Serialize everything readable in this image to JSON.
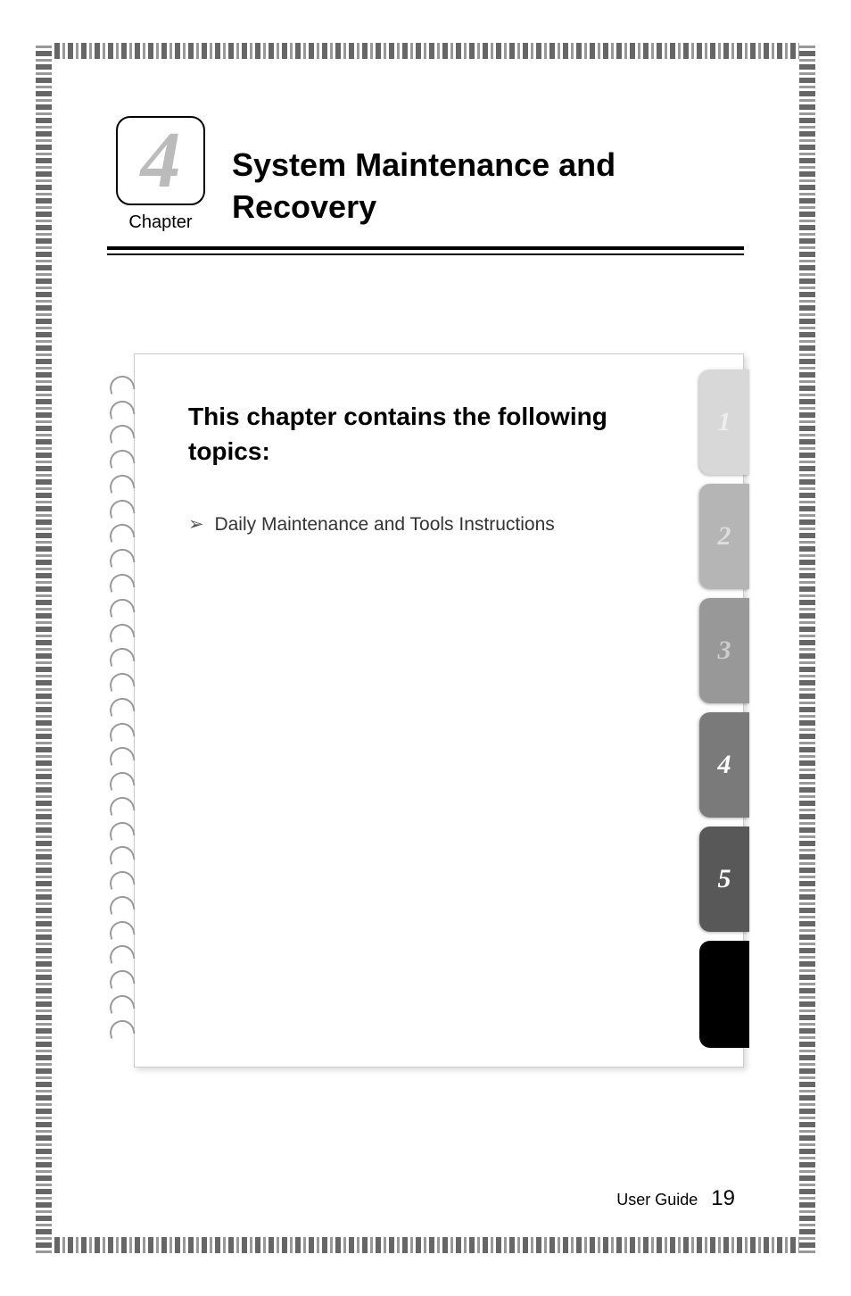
{
  "chapter": {
    "number": "4",
    "label": "Chapter",
    "title": "System Maintenance and Recovery"
  },
  "topics": {
    "heading": "This chapter contains the following topics:",
    "items": [
      "Daily Maintenance and Tools Instructions"
    ]
  },
  "tabs": [
    "1",
    "2",
    "3",
    "4",
    "5"
  ],
  "footer": {
    "label": "User Guide",
    "page": "19"
  }
}
